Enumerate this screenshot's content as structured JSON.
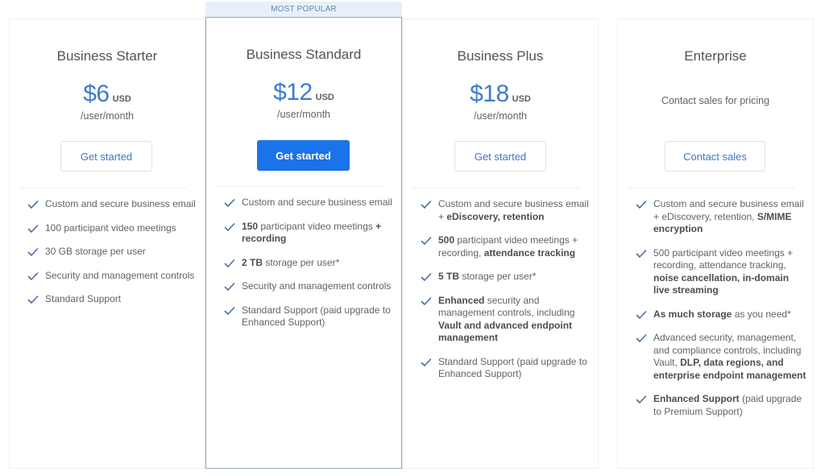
{
  "badge": {
    "label": "MOST POPULAR"
  },
  "plans": [
    {
      "name": "Business Starter",
      "price": "$6",
      "currency": "USD",
      "period": "/user/month",
      "button": "Get started",
      "features": [
        [
          {
            "t": "Custom and secure business email"
          }
        ],
        [
          {
            "t": "100 participant video meetings"
          }
        ],
        [
          {
            "t": "30 GB storage per user"
          }
        ],
        [
          {
            "t": "Security and management controls"
          }
        ],
        [
          {
            "t": "Standard Support"
          }
        ]
      ]
    },
    {
      "name": "Business Standard",
      "price": "$12",
      "currency": "USD",
      "period": "/user/month",
      "button": "Get started",
      "highlighted": true,
      "features": [
        [
          {
            "t": "Custom and secure business email"
          }
        ],
        [
          {
            "t": "150",
            "b": true
          },
          {
            "t": " participant video meetings "
          },
          {
            "t": "+ recording",
            "b": true
          }
        ],
        [
          {
            "t": "2 TB",
            "b": true
          },
          {
            "t": " storage per user*"
          }
        ],
        [
          {
            "t": "Security and management controls"
          }
        ],
        [
          {
            "t": "Standard Support (paid upgrade to Enhanced Support)"
          }
        ]
      ]
    },
    {
      "name": "Business Plus",
      "price": "$18",
      "currency": "USD",
      "period": "/user/month",
      "button": "Get started",
      "features": [
        [
          {
            "t": "Custom and secure business email + "
          },
          {
            "t": "eDiscovery, retention",
            "b": true
          }
        ],
        [
          {
            "t": "500",
            "b": true
          },
          {
            "t": " participant video meetings + recording, "
          },
          {
            "t": "attendance tracking",
            "b": true
          }
        ],
        [
          {
            "t": "5 TB",
            "b": true
          },
          {
            "t": " storage per user*"
          }
        ],
        [
          {
            "t": "Enhanced",
            "b": true
          },
          {
            "t": " security and management controls, including "
          },
          {
            "t": "Vault and advanced endpoint management",
            "b": true
          }
        ],
        [
          {
            "t": "Standard Support (paid upgrade to Enhanced Support)"
          }
        ]
      ]
    },
    {
      "name": "Enterprise",
      "note": "Contact sales for pricing",
      "button": "Contact sales",
      "features": [
        [
          {
            "t": "Custom and secure business email + eDiscovery, retention, "
          },
          {
            "t": "S/MIME encryption",
            "b": true
          }
        ],
        [
          {
            "t": "500 participant video meetings + recording, attendance tracking, "
          },
          {
            "t": "noise cancellation, in-domain live streaming",
            "b": true
          }
        ],
        [
          {
            "t": "As much storage",
            "b": true
          },
          {
            "t": " as you need*"
          }
        ],
        [
          {
            "t": "Advanced security, management, and compliance controls, including Vault, "
          },
          {
            "t": "DLP, data regions, and enterprise endpoint management",
            "b": true
          }
        ],
        [
          {
            "t": "Enhanced Support",
            "b": true
          },
          {
            "t": " (paid upgrade to Premium Support)"
          }
        ]
      ]
    }
  ],
  "icons": {
    "feature": "checkmark-icon"
  },
  "colors": {
    "accent": "#1a73e8",
    "price": "#3b7bd4",
    "check": "#4a6fa0",
    "highlight_border": "#8fa6bd",
    "badge_bg": "#e6f0fb"
  }
}
